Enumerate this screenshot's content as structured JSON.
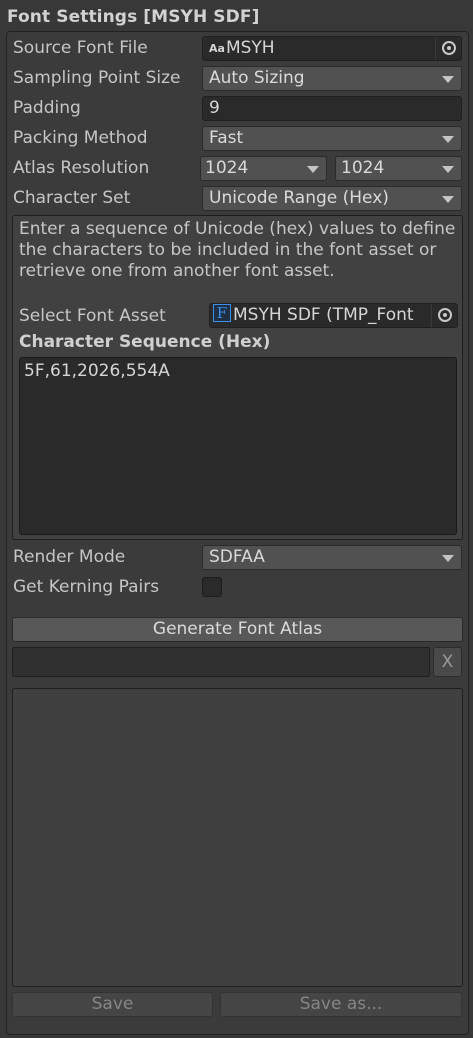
{
  "header": {
    "title": "Font Settings [MSYH SDF]"
  },
  "rows": {
    "source_font": {
      "label": "Source Font File",
      "value": "MSYH",
      "icon": "font-asset-icon"
    },
    "sampling": {
      "label": "Sampling Point Size",
      "value": "Auto Sizing"
    },
    "padding": {
      "label": "Padding",
      "value": "9"
    },
    "packing": {
      "label": "Packing Method",
      "value": "Fast"
    },
    "atlas": {
      "label": "Atlas Resolution",
      "width": "1024",
      "height": "1024"
    },
    "charset": {
      "label": "Character Set",
      "value": "Unicode Range (Hex)"
    }
  },
  "charset_box": {
    "help": "Enter a sequence of Unicode (hex) values to define the characters to be included in the font asset or retrieve one from another font asset.",
    "select_label": "Select Font Asset",
    "select_icon_glyph": "F",
    "select_value": "MSYH SDF (TMP_Font",
    "sequence_title": "Character Sequence (Hex)",
    "sequence_value": "5F,61,2026,554A"
  },
  "render": {
    "label": "Render Mode",
    "value": "SDFAA"
  },
  "kerning": {
    "label": "Get Kerning Pairs",
    "checked": false
  },
  "actions": {
    "generate": "Generate Font Atlas",
    "cancel": "X",
    "save": "Save",
    "save_as": "Save as...",
    "progress": 0
  },
  "colors": {
    "accent": "#3d8ee8",
    "background": "#383838",
    "field": "#2a2a2a",
    "dropdown": "#515151"
  }
}
